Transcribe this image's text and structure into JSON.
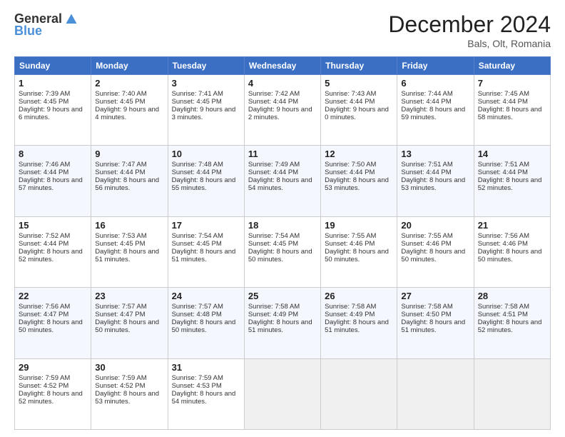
{
  "header": {
    "logo_general": "General",
    "logo_blue": "Blue",
    "title": "December 2024",
    "subtitle": "Bals, Olt, Romania"
  },
  "weekdays": [
    "Sunday",
    "Monday",
    "Tuesday",
    "Wednesday",
    "Thursday",
    "Friday",
    "Saturday"
  ],
  "weeks": [
    [
      {
        "day": "1",
        "sunrise": "7:39 AM",
        "sunset": "4:45 PM",
        "daylight": "9 hours and 6 minutes."
      },
      {
        "day": "2",
        "sunrise": "7:40 AM",
        "sunset": "4:45 PM",
        "daylight": "9 hours and 4 minutes."
      },
      {
        "day": "3",
        "sunrise": "7:41 AM",
        "sunset": "4:45 PM",
        "daylight": "9 hours and 3 minutes."
      },
      {
        "day": "4",
        "sunrise": "7:42 AM",
        "sunset": "4:44 PM",
        "daylight": "9 hours and 2 minutes."
      },
      {
        "day": "5",
        "sunrise": "7:43 AM",
        "sunset": "4:44 PM",
        "daylight": "9 hours and 0 minutes."
      },
      {
        "day": "6",
        "sunrise": "7:44 AM",
        "sunset": "4:44 PM",
        "daylight": "8 hours and 59 minutes."
      },
      {
        "day": "7",
        "sunrise": "7:45 AM",
        "sunset": "4:44 PM",
        "daylight": "8 hours and 58 minutes."
      }
    ],
    [
      {
        "day": "8",
        "sunrise": "7:46 AM",
        "sunset": "4:44 PM",
        "daylight": "8 hours and 57 minutes."
      },
      {
        "day": "9",
        "sunrise": "7:47 AM",
        "sunset": "4:44 PM",
        "daylight": "8 hours and 56 minutes."
      },
      {
        "day": "10",
        "sunrise": "7:48 AM",
        "sunset": "4:44 PM",
        "daylight": "8 hours and 55 minutes."
      },
      {
        "day": "11",
        "sunrise": "7:49 AM",
        "sunset": "4:44 PM",
        "daylight": "8 hours and 54 minutes."
      },
      {
        "day": "12",
        "sunrise": "7:50 AM",
        "sunset": "4:44 PM",
        "daylight": "8 hours and 53 minutes."
      },
      {
        "day": "13",
        "sunrise": "7:51 AM",
        "sunset": "4:44 PM",
        "daylight": "8 hours and 53 minutes."
      },
      {
        "day": "14",
        "sunrise": "7:51 AM",
        "sunset": "4:44 PM",
        "daylight": "8 hours and 52 minutes."
      }
    ],
    [
      {
        "day": "15",
        "sunrise": "7:52 AM",
        "sunset": "4:44 PM",
        "daylight": "8 hours and 52 minutes."
      },
      {
        "day": "16",
        "sunrise": "7:53 AM",
        "sunset": "4:45 PM",
        "daylight": "8 hours and 51 minutes."
      },
      {
        "day": "17",
        "sunrise": "7:54 AM",
        "sunset": "4:45 PM",
        "daylight": "8 hours and 51 minutes."
      },
      {
        "day": "18",
        "sunrise": "7:54 AM",
        "sunset": "4:45 PM",
        "daylight": "8 hours and 50 minutes."
      },
      {
        "day": "19",
        "sunrise": "7:55 AM",
        "sunset": "4:46 PM",
        "daylight": "8 hours and 50 minutes."
      },
      {
        "day": "20",
        "sunrise": "7:55 AM",
        "sunset": "4:46 PM",
        "daylight": "8 hours and 50 minutes."
      },
      {
        "day": "21",
        "sunrise": "7:56 AM",
        "sunset": "4:46 PM",
        "daylight": "8 hours and 50 minutes."
      }
    ],
    [
      {
        "day": "22",
        "sunrise": "7:56 AM",
        "sunset": "4:47 PM",
        "daylight": "8 hours and 50 minutes."
      },
      {
        "day": "23",
        "sunrise": "7:57 AM",
        "sunset": "4:47 PM",
        "daylight": "8 hours and 50 minutes."
      },
      {
        "day": "24",
        "sunrise": "7:57 AM",
        "sunset": "4:48 PM",
        "daylight": "8 hours and 50 minutes."
      },
      {
        "day": "25",
        "sunrise": "7:58 AM",
        "sunset": "4:49 PM",
        "daylight": "8 hours and 51 minutes."
      },
      {
        "day": "26",
        "sunrise": "7:58 AM",
        "sunset": "4:49 PM",
        "daylight": "8 hours and 51 minutes."
      },
      {
        "day": "27",
        "sunrise": "7:58 AM",
        "sunset": "4:50 PM",
        "daylight": "8 hours and 51 minutes."
      },
      {
        "day": "28",
        "sunrise": "7:58 AM",
        "sunset": "4:51 PM",
        "daylight": "8 hours and 52 minutes."
      }
    ],
    [
      {
        "day": "29",
        "sunrise": "7:59 AM",
        "sunset": "4:52 PM",
        "daylight": "8 hours and 52 minutes."
      },
      {
        "day": "30",
        "sunrise": "7:59 AM",
        "sunset": "4:52 PM",
        "daylight": "8 hours and 53 minutes."
      },
      {
        "day": "31",
        "sunrise": "7:59 AM",
        "sunset": "4:53 PM",
        "daylight": "8 hours and 54 minutes."
      },
      null,
      null,
      null,
      null
    ]
  ]
}
